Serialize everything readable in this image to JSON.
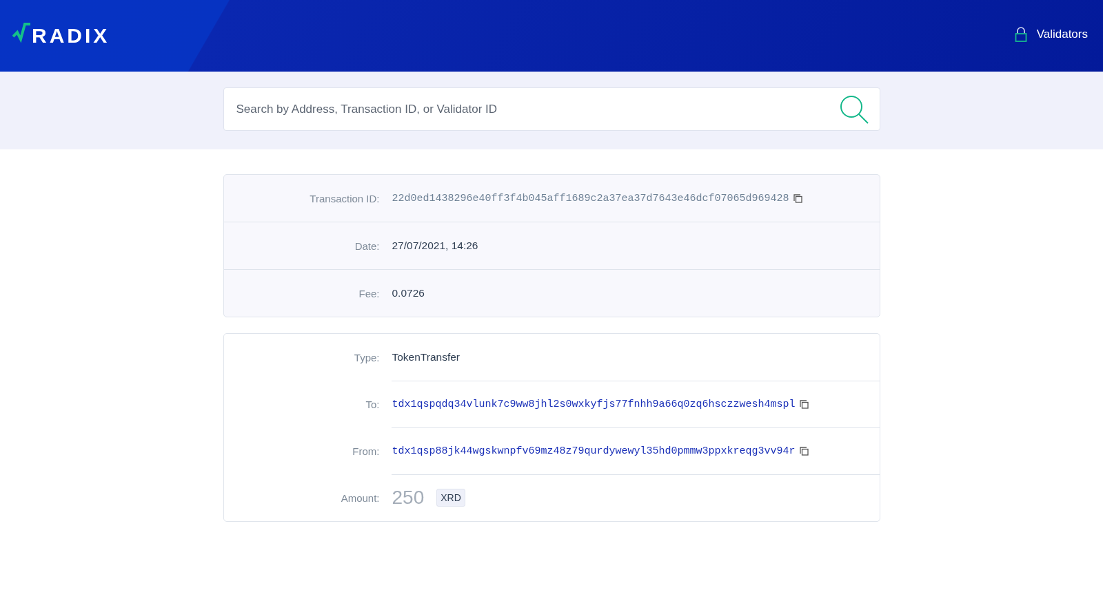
{
  "header": {
    "logo": "RADIX",
    "nav": [
      {
        "label": "Validators"
      }
    ]
  },
  "search": {
    "placeholder": "Search by Address, Transaction ID, or Validator ID"
  },
  "cards": [
    {
      "rows": [
        {
          "label": "Transaction ID:",
          "value": "22d0ed1438296e40ff3f4b045aff1689c2a37ea37d7643e46dcf07065d969428",
          "kind": "mono",
          "copyable": true
        },
        {
          "label": "Date:",
          "value": "27/07/2021, 14:26",
          "kind": "text",
          "copyable": false
        },
        {
          "label": "Fee:",
          "value": "0.0726",
          "kind": "text",
          "copyable": false
        }
      ]
    },
    {
      "rows": [
        {
          "label": "Type:",
          "value": "TokenTransfer",
          "kind": "text",
          "copyable": false
        },
        {
          "label": "To:",
          "value": "tdx1qspqdq34vlunk7c9ww8jhl2s0wxkyfjs77fnhh9a66q0zq6hsczzwesh4mspl",
          "kind": "link",
          "copyable": true
        },
        {
          "label": "From:",
          "value": "tdx1qsp88jk44wgskwnpfv69mz48z79qurdywewyl35hd0pmmw3ppxkreqg3vv94r",
          "kind": "link",
          "copyable": true
        },
        {
          "label": "Amount:",
          "value": "250",
          "kind": "amount",
          "unit": "XRD",
          "copyable": false
        }
      ]
    }
  ]
}
